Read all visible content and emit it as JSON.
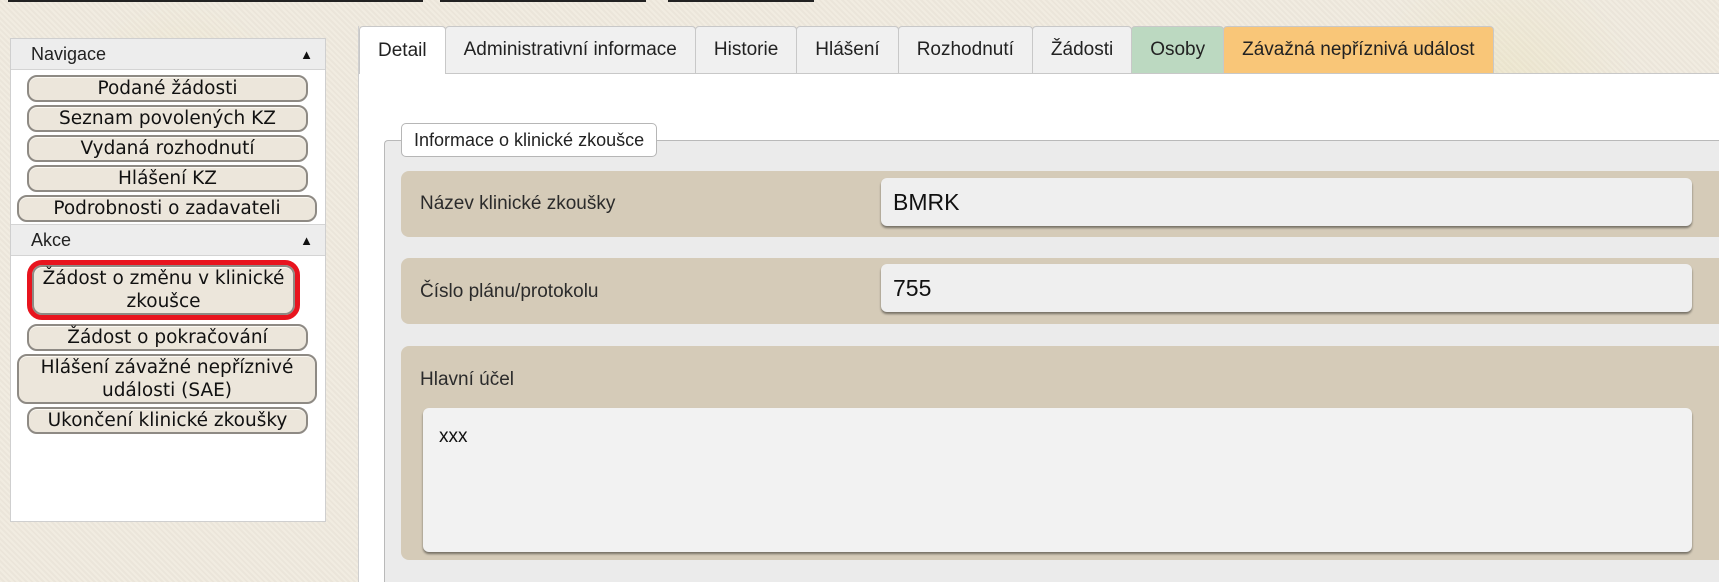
{
  "sidebar": {
    "nav_title": "Navigace",
    "nav_items": [
      "Podané žádosti",
      "Seznam povolených KZ",
      "Vydaná rozhodnutí",
      "Hlášení KZ",
      "Podrobnosti o zadavateli"
    ],
    "actions_title": "Akce",
    "action_items": [
      "Žádost o změnu v klinické zkoušce",
      "Žádost o pokračování",
      "Hlášení závažné nepříznivé události (SAE)",
      "Ukončení klinické zkoušky"
    ]
  },
  "tabs": [
    "Detail",
    "Administrativní informace",
    "Historie",
    "Hlášení",
    "Rozhodnutí",
    "Žádosti",
    "Osoby",
    "Závažná nepříznivá událost"
  ],
  "section": {
    "legend": "Informace o klinické zkoušce",
    "fields": [
      {
        "label": "Název klinické zkoušky",
        "value": "BMRK"
      },
      {
        "label": "Číslo plánu/protokolu",
        "value": "755"
      },
      {
        "label": "Hlavní účel",
        "value": "xxx"
      }
    ]
  },
  "colors": {
    "highlight": "#e8141e",
    "tab_osoby": "#bcd9c1",
    "tab_sae": "#f9c678",
    "field_row": "#d5cbb8"
  }
}
